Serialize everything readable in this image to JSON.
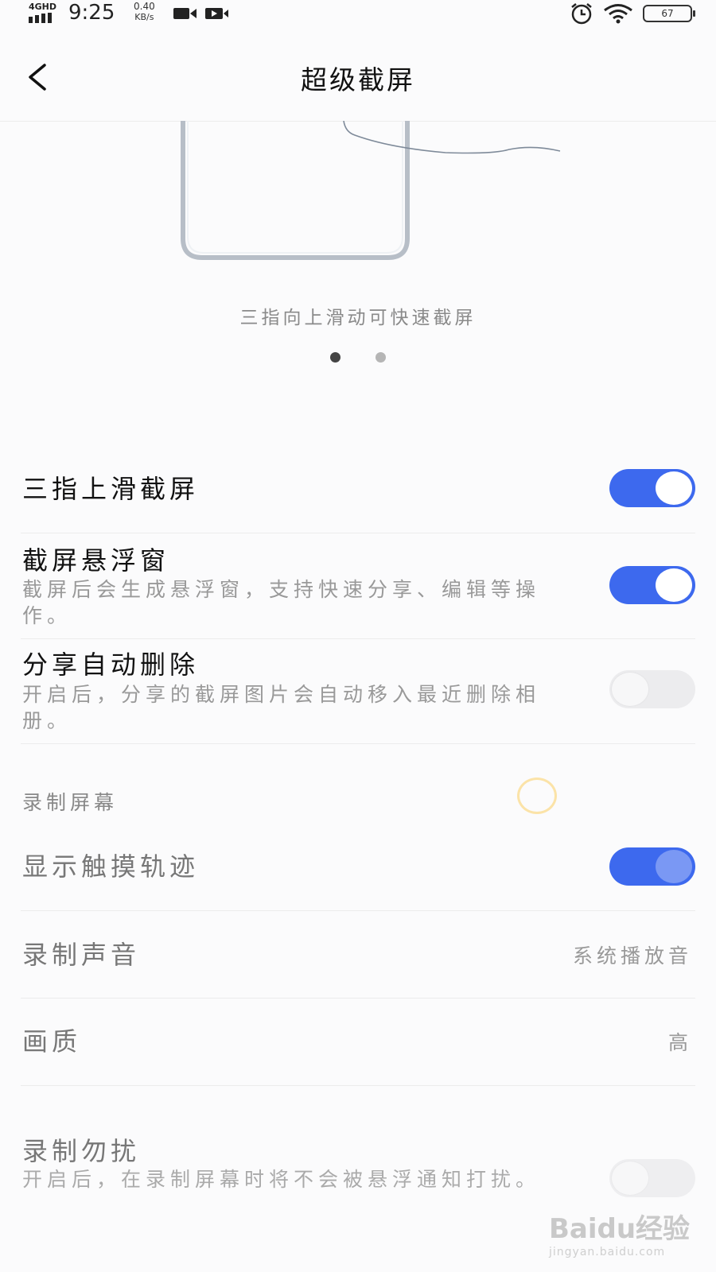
{
  "status_bar": {
    "network": "4GHD",
    "time": "9:25",
    "speed_value": "0.40",
    "speed_unit": "KB/s",
    "battery": "67",
    "icons": [
      "signal-bars-icon",
      "video-camera-icon",
      "video-record-icon",
      "alarm-icon",
      "wifi-icon",
      "battery-icon"
    ]
  },
  "header": {
    "title": "超级截屏",
    "back_icon": "back-arrow-icon"
  },
  "illustration": {
    "caption": "三指向上滑动可快速截屏",
    "page_count": 2,
    "active_page": 1
  },
  "settings": {
    "three_finger": {
      "title": "三指上滑截屏",
      "enabled": true
    },
    "float_window": {
      "title": "截屏悬浮窗",
      "desc": "截屏后会生成悬浮窗，支持快速分享、编辑等操作。",
      "enabled": true
    },
    "auto_delete": {
      "title": "分享自动删除",
      "desc": "开启后，分享的截屏图片会自动移入最近删除相册。",
      "enabled": false
    },
    "record_section": "录制屏幕",
    "show_touch": {
      "title": "显示触摸轨迹",
      "enabled": true
    },
    "record_sound": {
      "title": "录制声音",
      "value": "系统播放音"
    },
    "quality": {
      "title": "画质",
      "value": "高"
    },
    "dnd": {
      "title": "录制勿扰",
      "desc": "开启后，在录制屏幕时将不会被悬浮通知打扰。",
      "enabled": false
    }
  },
  "watermark": {
    "brand": "Baidu经验",
    "url": "jingyan.baidu.com"
  },
  "colors": {
    "accent": "#3d69ee",
    "toggle_off": "#ececee",
    "secondary_text": "#999999"
  }
}
